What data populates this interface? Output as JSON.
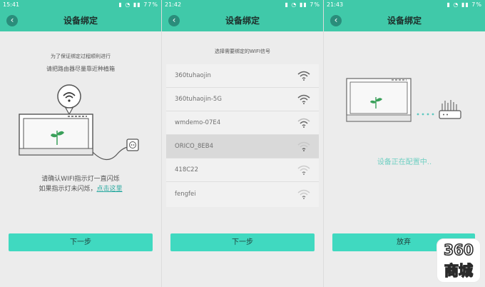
{
  "colors": {
    "accent": "#40c9a9",
    "button": "#40d9c0",
    "link": "#2aa9a0",
    "configuring": "#6fcfc2"
  },
  "screens": [
    {
      "status": {
        "time": "15:41",
        "battery": "77%"
      },
      "title": "设备绑定",
      "line1": "为了保证绑定过程顺利进行",
      "line2": "请把路由器尽量靠近种植箱",
      "confirm1": "请确认WIFI指示灯一直闪烁",
      "confirm2_prefix": "如果指示灯未闪烁，",
      "confirm2_link": "点击这里",
      "button": "下一步"
    },
    {
      "status": {
        "time": "21:42",
        "battery": "7%"
      },
      "title": "设备绑定",
      "instruction": "选择需要绑定的WIFI信号",
      "networks": [
        "360tuhaojin",
        "360tuhaojin-5G",
        "wmdemo-07E4",
        "ORICO_8EB4",
        "418C22",
        "fengfei"
      ],
      "selected_index": 3,
      "button": "下一步"
    },
    {
      "status": {
        "time": "21:43",
        "battery": "7%"
      },
      "title": "设备绑定",
      "configuring": "设备正在配置中..",
      "button": "放弃"
    }
  ],
  "badge": {
    "top": "360",
    "bottom": "商城"
  }
}
